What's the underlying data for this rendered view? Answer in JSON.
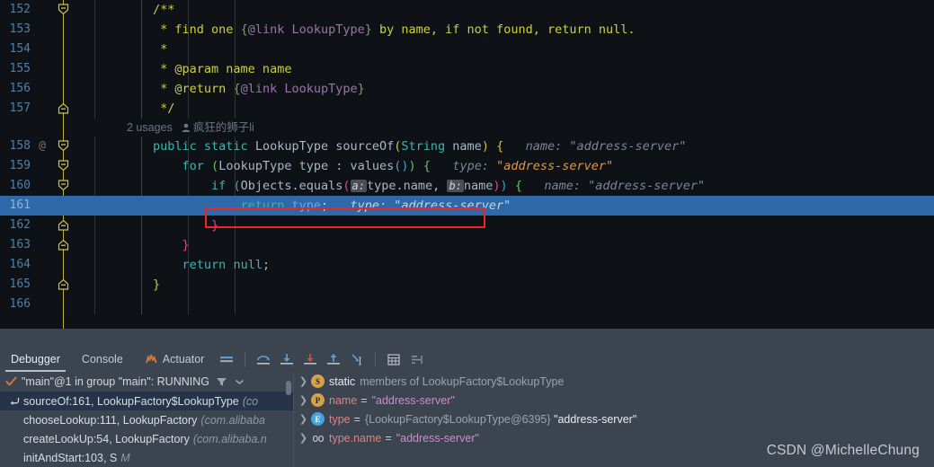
{
  "editor": {
    "lines": [
      {
        "number": "152",
        "gutter_annotation": "",
        "fold": "collapse-start",
        "content_html": "<span class='cmt'>        /**</span>"
      },
      {
        "number": "153",
        "gutter_annotation": "",
        "fold": "",
        "content_html": "<span class='cmt'>         * find one </span><span class='cmt-br'>{</span><span class='cmt-tag'>@link LookupType</span><span class='cmt-br'>}</span><span class='cmt'> by name, if not found, return null.</span>"
      },
      {
        "number": "154",
        "gutter_annotation": "",
        "fold": "",
        "content_html": "<span class='cmt'>         *</span>"
      },
      {
        "number": "155",
        "gutter_annotation": "",
        "fold": "",
        "content_html": "<span class='cmt'>         * @param name name</span>"
      },
      {
        "number": "156",
        "gutter_annotation": "",
        "fold": "",
        "content_html": "<span class='cmt'>         * @return </span><span class='cmt-br'>{</span><span class='cmt-tag'>@link LookupType</span><span class='cmt-br'>}</span>"
      },
      {
        "number": "157",
        "gutter_annotation": "",
        "fold": "collapse-end",
        "content_html": "<span class='cmt'>         */</span>"
      },
      {
        "number": "158",
        "gutter_annotation": "@",
        "fold": "collapse-start",
        "content_html": "<span class='kw2'>        public static </span><span class='type'>LookupType </span><span class='meth'>sourceOf</span><span class='brace-y'>(</span><span class='kw2'>String </span><span class='ident'>name</span><span class='brace-y'>)</span><span class='brace-y'> {</span><span class='hint'>   name: </span><span class='hint'>\"address-server\"</span>"
      },
      {
        "number": "159",
        "gutter_annotation": "",
        "fold": "collapse-start",
        "content_html": "<span class='kw2'>            for </span><span class='brace-g'>(</span><span class='type'>LookupType </span><span class='ident'>type </span><span class='punct'>: </span><span class='meth'>values</span><span class='brace-b'>()</span><span class='brace-g'>)</span><span class='brace-g'> {</span><span class='hint'>   type: </span><span class='hint-orange'>\"address-server\"</span>"
      },
      {
        "number": "160",
        "gutter_annotation": "",
        "fold": "collapse-start",
        "content_html": "<span class='kw2'>                if </span><span class='brace-b'>(</span><span class='type'>Objects</span><span class='punct'>.</span><span class='meth'>equals</span><span class='brace-m'>(</span><span class='chip'>a:</span><span class='ident'>type</span><span class='punct'>.</span><span class='ident'>name</span><span class='punct'>, </span><span class='chip'>b:</span><span class='ident'>name</span><span class='brace-m'>)</span><span class='brace-b'>)</span><span class='brace-g'> {</span><span class='hint'>   name: </span><span class='hint'>\"address-server\"</span>"
      },
      {
        "number": "161",
        "gutter_annotation": "",
        "fold": "",
        "selected": true,
        "content_html": "<span style='color:#3cb5b0'>                    return </span><span style='color:#6fa8dc'>type</span><span style='color:#cfdcea'>;</span><span class='hint'>   type: </span><span class='hint'>\"address-server\"</span>"
      },
      {
        "number": "162",
        "gutter_annotation": "",
        "fold": "collapse-end",
        "content_html": "<span class='brace-m'>                }</span>"
      },
      {
        "number": "163",
        "gutter_annotation": "",
        "fold": "collapse-end",
        "content_html": "<span class='brace-m'>            }</span>"
      },
      {
        "number": "164",
        "gutter_annotation": "",
        "fold": "",
        "content_html": "<span class='kw2'>            return </span><span class='kw2'>null</span><span class='punct'>;</span>"
      },
      {
        "number": "165",
        "gutter_annotation": "",
        "fold": "collapse-end",
        "content_html": "<span class='brace-y'>        }</span>"
      },
      {
        "number": "166",
        "gutter_annotation": "",
        "fold": "",
        "content_html": ""
      }
    ],
    "usages_label": "2 usages",
    "author_label": "疯狂的狮子li",
    "highlight_box_color": "#ef2424",
    "selected_line_color": "#2e68a8",
    "background_color": "#0e1116"
  },
  "debug_panel": {
    "tabs": [
      {
        "label": "Debugger",
        "icon": "",
        "active": true
      },
      {
        "label": "Console",
        "icon": "",
        "active": false
      },
      {
        "label": "Actuator",
        "icon": "actuator-icon",
        "active": false
      }
    ],
    "toolbar_buttons": [
      {
        "name": "layout-settings-icon",
        "title": "Layout Settings"
      },
      {
        "name": "step-over-icon",
        "title": "Step Over"
      },
      {
        "name": "step-into-icon",
        "title": "Step Into"
      },
      {
        "name": "force-step-into-icon",
        "title": "Force Step Into"
      },
      {
        "name": "step-out-icon",
        "title": "Step Out"
      },
      {
        "name": "run-to-cursor-icon",
        "title": "Run to Cursor"
      },
      {
        "name": "evaluate-expression-icon",
        "title": "Evaluate Expression"
      },
      {
        "name": "sort-variables-icon",
        "title": "Sort Variables"
      }
    ],
    "thread": {
      "label": "\"main\"@1 in group \"main\": RUNNING",
      "status_icon": "check-icon",
      "filter_icon": "filter-icon",
      "dropdown_icon": "chevron-down-icon"
    },
    "frames": [
      {
        "method": "sourceOf:161, LookupFactory$LookupType",
        "package": "(co",
        "selected": true
      },
      {
        "method": "chooseLookup:111, LookupFactory",
        "package": "(com.alibaba",
        "selected": false
      },
      {
        "method": "createLookUp:54, LookupFactory",
        "package": "(com.alibaba.n",
        "selected": false
      },
      {
        "method": "initAndStart:103, S",
        "package": "M",
        "selected": false
      }
    ],
    "variables": [
      {
        "icon": "s",
        "icon_name": "static-member-icon",
        "keyword": "static",
        "name": "",
        "dim_text": "members of LookupFactory$LookupType",
        "equals": "",
        "value": "",
        "ref": ""
      },
      {
        "icon": "p",
        "icon_name": "primitive-field-icon",
        "keyword": "",
        "name": "name",
        "dim_text": "",
        "equals": "=",
        "value": "\"address-server\"",
        "ref": ""
      },
      {
        "icon": "e",
        "icon_name": "enum-field-icon",
        "keyword": "",
        "name": "type",
        "dim_text": "",
        "equals": "=",
        "ref": "{LookupFactory$LookupType@6395}",
        "value": "\"address-server\""
      },
      {
        "icon": "oo",
        "icon_name": "field-watch-icon",
        "keyword": "",
        "name": "type.name",
        "dim_text": "",
        "equals": "=",
        "value": "\"address-server\"",
        "ref": ""
      }
    ]
  },
  "watermark": "CSDN @MichelleChung"
}
